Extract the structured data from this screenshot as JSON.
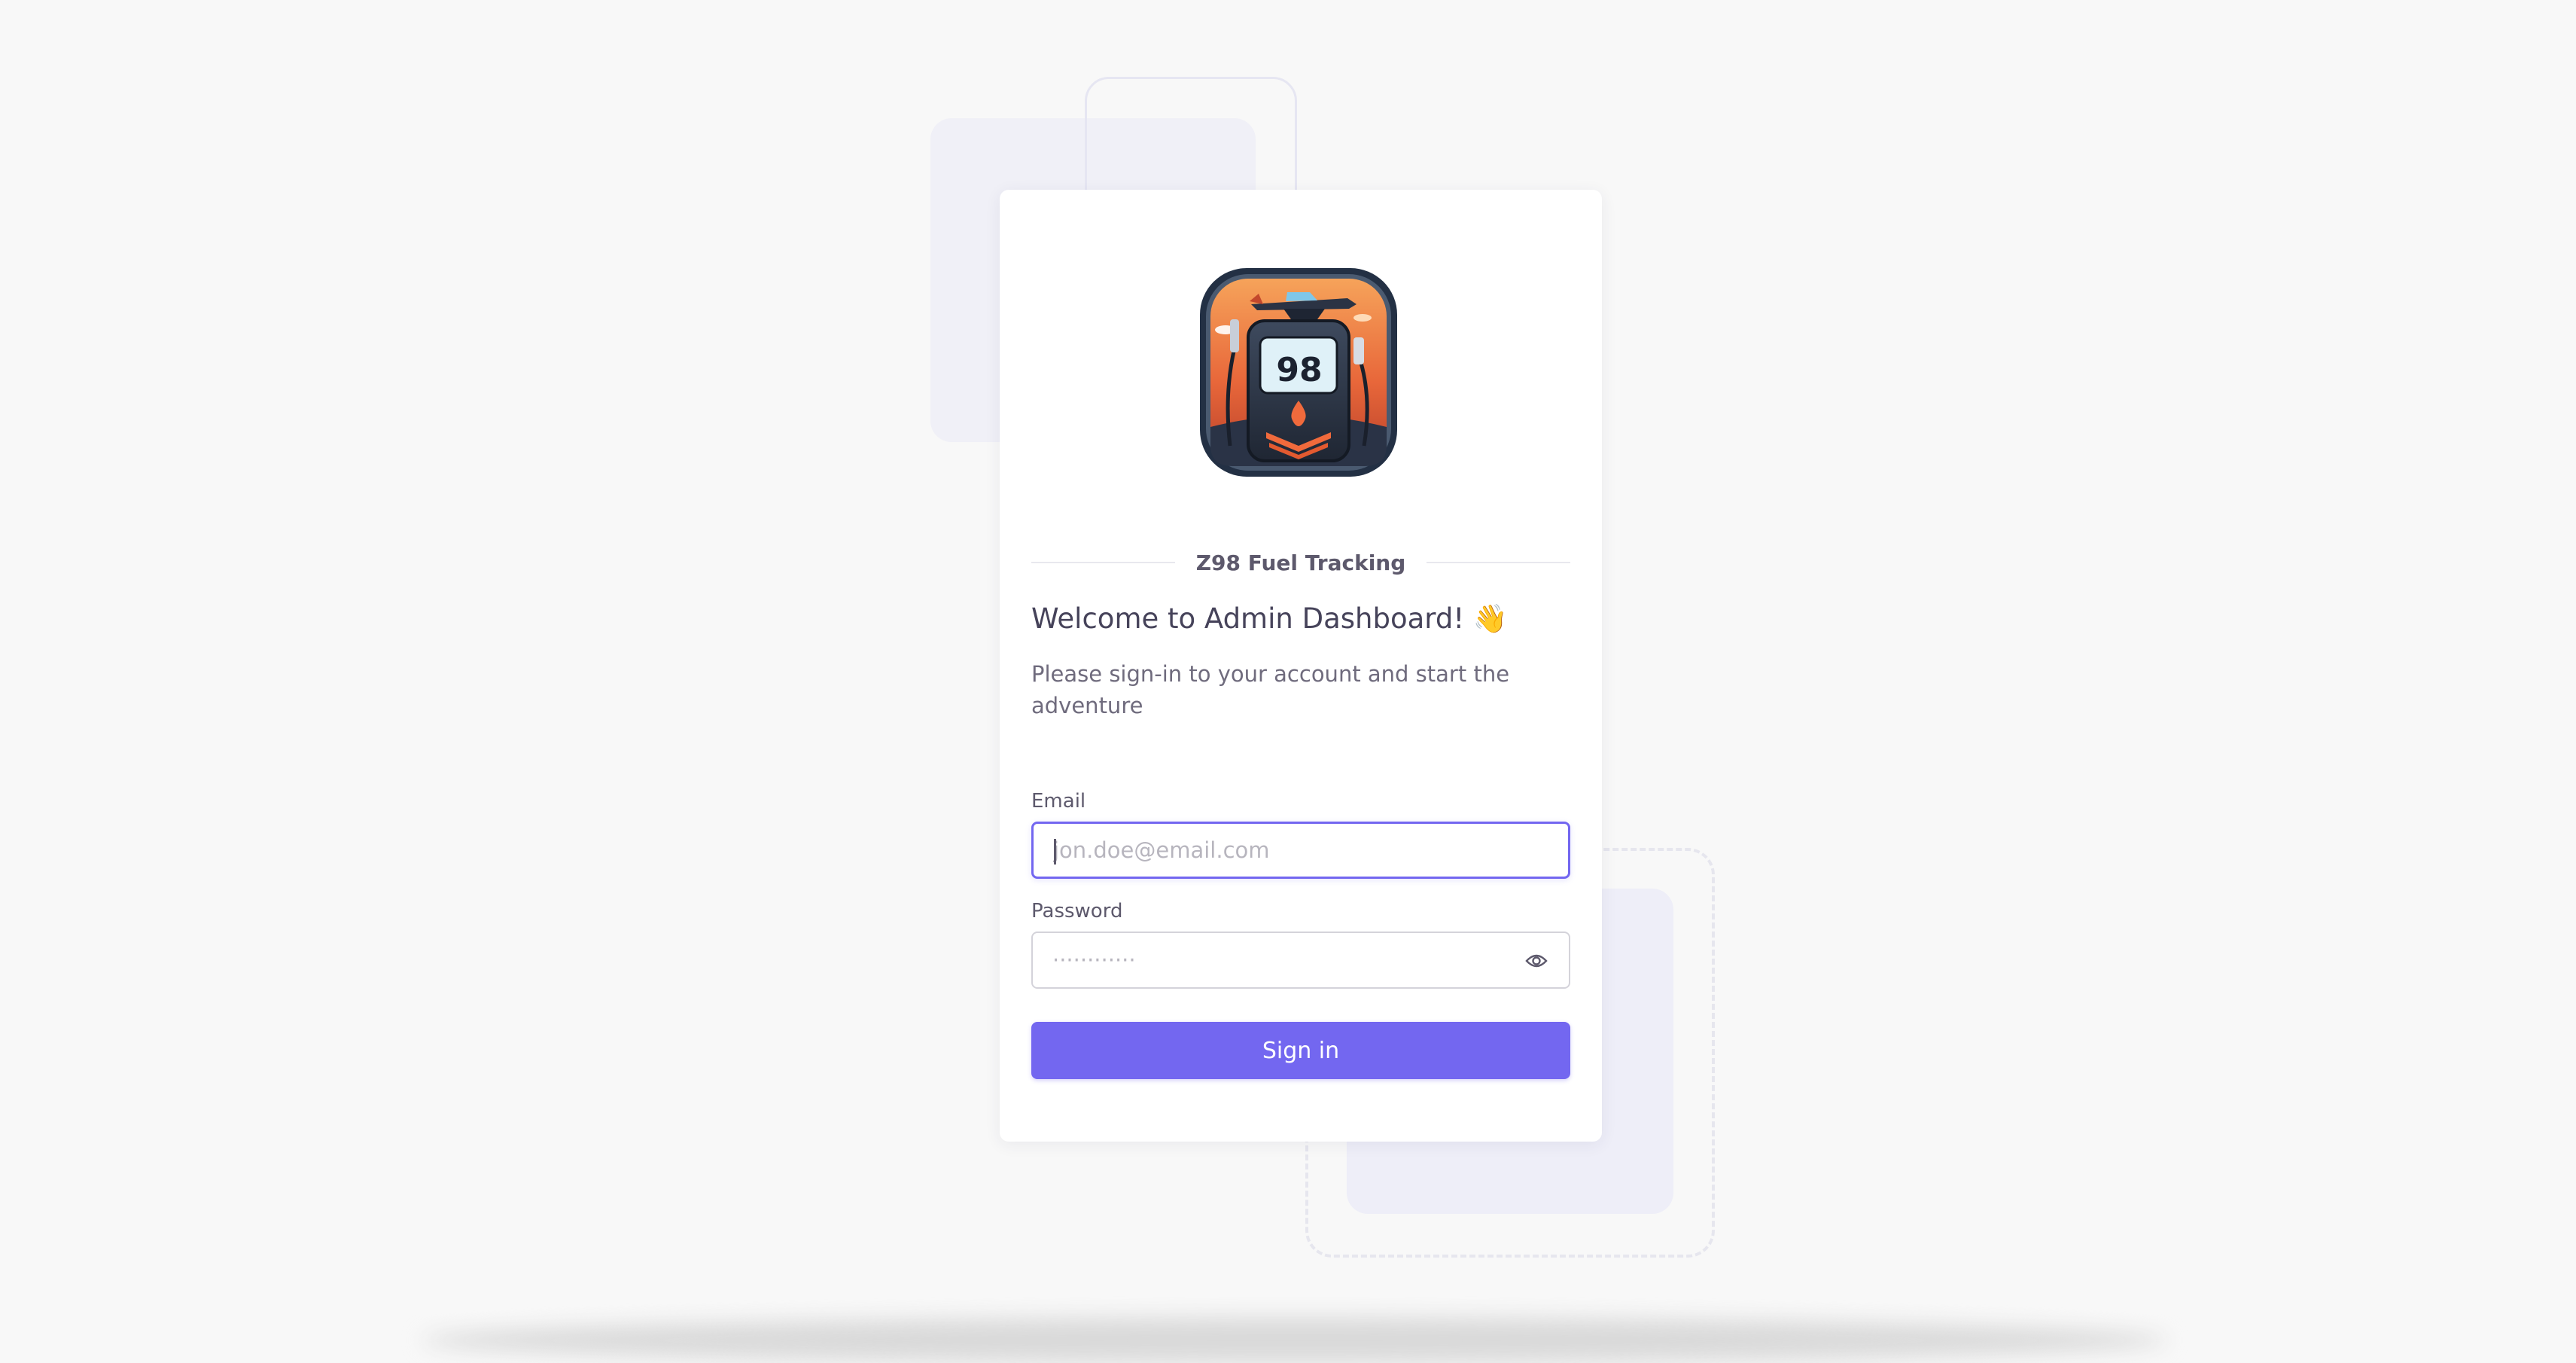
{
  "brand": {
    "name": "Z98 Fuel Tracking",
    "logo_text": "98"
  },
  "login": {
    "title": "Welcome to Admin Dashboard! 👋",
    "subtitle": "Please sign-in to your account and start the adventure",
    "email": {
      "label": "Email",
      "placeholder": "jon.doe@email.com",
      "value": ""
    },
    "password": {
      "label": "Password",
      "placeholder": "············",
      "value": ""
    },
    "submit_label": "Sign in"
  },
  "colors": {
    "primary": "#7367f0",
    "background": "#f8f8f8",
    "text": "#5d596c"
  },
  "icons": {
    "password_toggle": "eye-icon"
  }
}
